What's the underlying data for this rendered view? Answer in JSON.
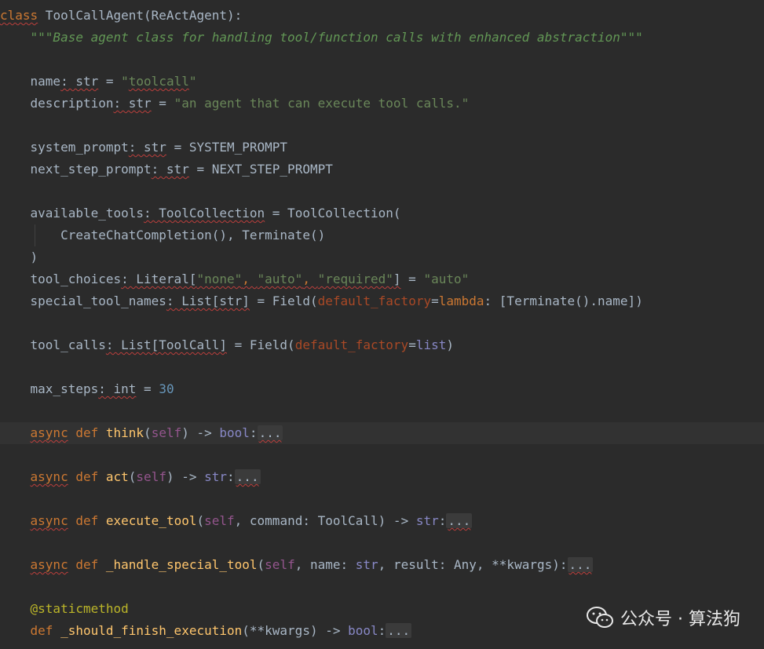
{
  "editor": {
    "lines": [
      {
        "tokens": [
          {
            "text": "class",
            "c": "kw warn"
          },
          {
            "text": " ToolCallAgent(ReActAgent):",
            "c": ""
          }
        ]
      },
      {
        "tokens": [
          {
            "text": "    ",
            "c": ""
          },
          {
            "text": "\"\"\"Base agent class for handling tool/function calls with enhanced abstraction\"\"\"",
            "c": "doc"
          }
        ]
      },
      {
        "tokens": []
      },
      {
        "tokens": [
          {
            "text": "    name",
            "c": ""
          },
          {
            "text": ": str",
            "c": "warn"
          },
          {
            "text": " = ",
            "c": ""
          },
          {
            "text": "\"",
            "c": "str"
          },
          {
            "text": "toolcall",
            "c": "str warn"
          },
          {
            "text": "\"",
            "c": "str"
          }
        ]
      },
      {
        "tokens": [
          {
            "text": "    description",
            "c": ""
          },
          {
            "text": ": str",
            "c": "warn"
          },
          {
            "text": " = ",
            "c": ""
          },
          {
            "text": "\"an agent that can execute tool calls.\"",
            "c": "str"
          }
        ]
      },
      {
        "tokens": []
      },
      {
        "tokens": [
          {
            "text": "    system_prompt",
            "c": ""
          },
          {
            "text": ": str",
            "c": "warn"
          },
          {
            "text": " = SYSTEM_PROMPT",
            "c": ""
          }
        ]
      },
      {
        "tokens": [
          {
            "text": "    next_step_prompt",
            "c": ""
          },
          {
            "text": ": str",
            "c": "warn"
          },
          {
            "text": " = NEXT_STEP_PROMPT",
            "c": ""
          }
        ]
      },
      {
        "tokens": []
      },
      {
        "tokens": [
          {
            "text": "    available_tools",
            "c": ""
          },
          {
            "text": ": ToolCollection",
            "c": "warn"
          },
          {
            "text": " = ToolCollection(",
            "c": ""
          }
        ]
      },
      {
        "tokens": [
          {
            "text": "        CreateChatCompletion(), Terminate()",
            "c": ""
          }
        ]
      },
      {
        "tokens": [
          {
            "text": "    )",
            "c": ""
          }
        ]
      },
      {
        "tokens": [
          {
            "text": "    tool_choices",
            "c": ""
          },
          {
            "text": ": Literal[",
            "c": "warn"
          },
          {
            "text": "\"none\"",
            "c": "str warn"
          },
          {
            "text": ", ",
            "c": "kw warn"
          },
          {
            "text": "\"auto\"",
            "c": "str warn"
          },
          {
            "text": ", ",
            "c": "kw warn"
          },
          {
            "text": "\"required\"",
            "c": "str warn"
          },
          {
            "text": "]",
            "c": "warn"
          },
          {
            "text": " = ",
            "c": ""
          },
          {
            "text": "\"auto\"",
            "c": "str"
          }
        ]
      },
      {
        "tokens": [
          {
            "text": "    special_tool_names",
            "c": ""
          },
          {
            "text": ": List[str]",
            "c": "warn"
          },
          {
            "text": " = Field(",
            "c": ""
          },
          {
            "text": "default_factory",
            "c": "param"
          },
          {
            "text": "=",
            "c": ""
          },
          {
            "text": "lambda",
            "c": "kw"
          },
          {
            "text": ": [Terminate().name])",
            "c": ""
          }
        ]
      },
      {
        "tokens": []
      },
      {
        "tokens": [
          {
            "text": "    tool_calls",
            "c": ""
          },
          {
            "text": ": List[ToolCall]",
            "c": "warn"
          },
          {
            "text": " = Field(",
            "c": ""
          },
          {
            "text": "default_factory",
            "c": "param"
          },
          {
            "text": "=",
            "c": ""
          },
          {
            "text": "list",
            "c": "builtin"
          },
          {
            "text": ")",
            "c": ""
          }
        ]
      },
      {
        "tokens": []
      },
      {
        "tokens": [
          {
            "text": "    max_steps",
            "c": ""
          },
          {
            "text": ": int",
            "c": "warn"
          },
          {
            "text": " = ",
            "c": ""
          },
          {
            "text": "30",
            "c": "num"
          }
        ]
      },
      {
        "tokens": []
      },
      {
        "current": true,
        "tokens": [
          {
            "text": "    ",
            "c": ""
          },
          {
            "text": "async",
            "c": "kw warn"
          },
          {
            "text": " def ",
            "c": "kw"
          },
          {
            "text": "think",
            "c": "fn"
          },
          {
            "text": "(",
            "c": ""
          },
          {
            "text": "self",
            "c": "self"
          },
          {
            "text": ") -> ",
            "c": ""
          },
          {
            "text": "bool",
            "c": "builtin"
          },
          {
            "text": ":",
            "c": ""
          },
          {
            "text": "...",
            "c": "fold warn"
          }
        ]
      },
      {
        "tokens": []
      },
      {
        "tokens": [
          {
            "text": "    ",
            "c": ""
          },
          {
            "text": "async",
            "c": "kw warn"
          },
          {
            "text": " def ",
            "c": "kw"
          },
          {
            "text": "act",
            "c": "fn"
          },
          {
            "text": "(",
            "c": ""
          },
          {
            "text": "self",
            "c": "self"
          },
          {
            "text": ") -> ",
            "c": ""
          },
          {
            "text": "str",
            "c": "builtin"
          },
          {
            "text": ":",
            "c": ""
          },
          {
            "text": "...",
            "c": "fold warn"
          }
        ]
      },
      {
        "tokens": []
      },
      {
        "tokens": [
          {
            "text": "    ",
            "c": ""
          },
          {
            "text": "async",
            "c": "kw warn"
          },
          {
            "text": " def ",
            "c": "kw"
          },
          {
            "text": "execute_tool",
            "c": "fn"
          },
          {
            "text": "(",
            "c": ""
          },
          {
            "text": "self",
            "c": "self"
          },
          {
            "text": ", command: ToolCall) -> ",
            "c": ""
          },
          {
            "text": "str",
            "c": "builtin"
          },
          {
            "text": ":",
            "c": ""
          },
          {
            "text": "...",
            "c": "fold warn"
          }
        ]
      },
      {
        "tokens": []
      },
      {
        "tokens": [
          {
            "text": "    ",
            "c": ""
          },
          {
            "text": "async",
            "c": "kw warn"
          },
          {
            "text": " def ",
            "c": "kw"
          },
          {
            "text": "_handle_special_tool",
            "c": "fn"
          },
          {
            "text": "(",
            "c": ""
          },
          {
            "text": "self",
            "c": "self"
          },
          {
            "text": ", name: ",
            "c": ""
          },
          {
            "text": "str",
            "c": "builtin"
          },
          {
            "text": ", result: Any, **kwargs):",
            "c": ""
          },
          {
            "text": "...",
            "c": "fold warn"
          }
        ]
      },
      {
        "tokens": []
      },
      {
        "tokens": [
          {
            "text": "    ",
            "c": ""
          },
          {
            "text": "@staticmethod",
            "c": "dec"
          }
        ]
      },
      {
        "tokens": [
          {
            "text": "    ",
            "c": ""
          },
          {
            "text": "def ",
            "c": "kw"
          },
          {
            "text": "_should_finish_execution",
            "c": "fn"
          },
          {
            "text": "(**kwargs) -> ",
            "c": ""
          },
          {
            "text": "bool",
            "c": "builtin"
          },
          {
            "text": ":",
            "c": ""
          },
          {
            "text": "...",
            "c": "fold"
          }
        ]
      }
    ]
  },
  "watermark": {
    "text": "公众号 · 算法狗",
    "icon": "wechat-icon"
  }
}
